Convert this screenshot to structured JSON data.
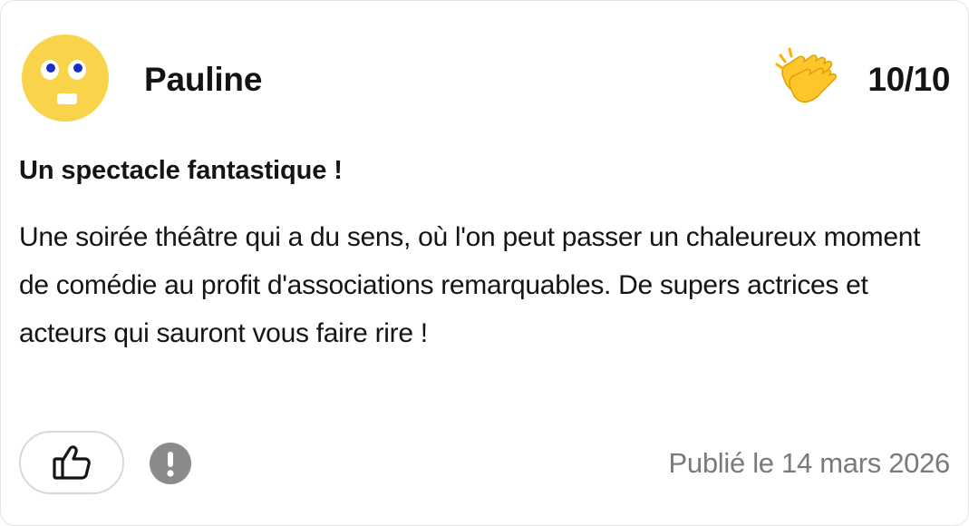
{
  "review": {
    "author": "Pauline",
    "avatar_icon": "rolling-eyes-face-icon",
    "rating_icon": "clapping-hands-icon",
    "rating": "10/10",
    "title": "Un spectacle fantastique !",
    "body": "Une soirée théâtre qui a du sens, où l'on peut passer un chaleureux moment de comédie au profit d'associations remarquables. De supers actrices et acteurs qui sauront vous faire rire !",
    "published": "Publié le 14 mars 2026"
  },
  "actions": {
    "like_icon": "thumbs-up-icon",
    "report_icon": "exclamation-icon"
  },
  "colors": {
    "avatar_yellow": "#F9D34A",
    "clap_yellow": "#FFC62B",
    "report_gray": "#8A8A8A",
    "muted_text": "#7A7A7A"
  }
}
